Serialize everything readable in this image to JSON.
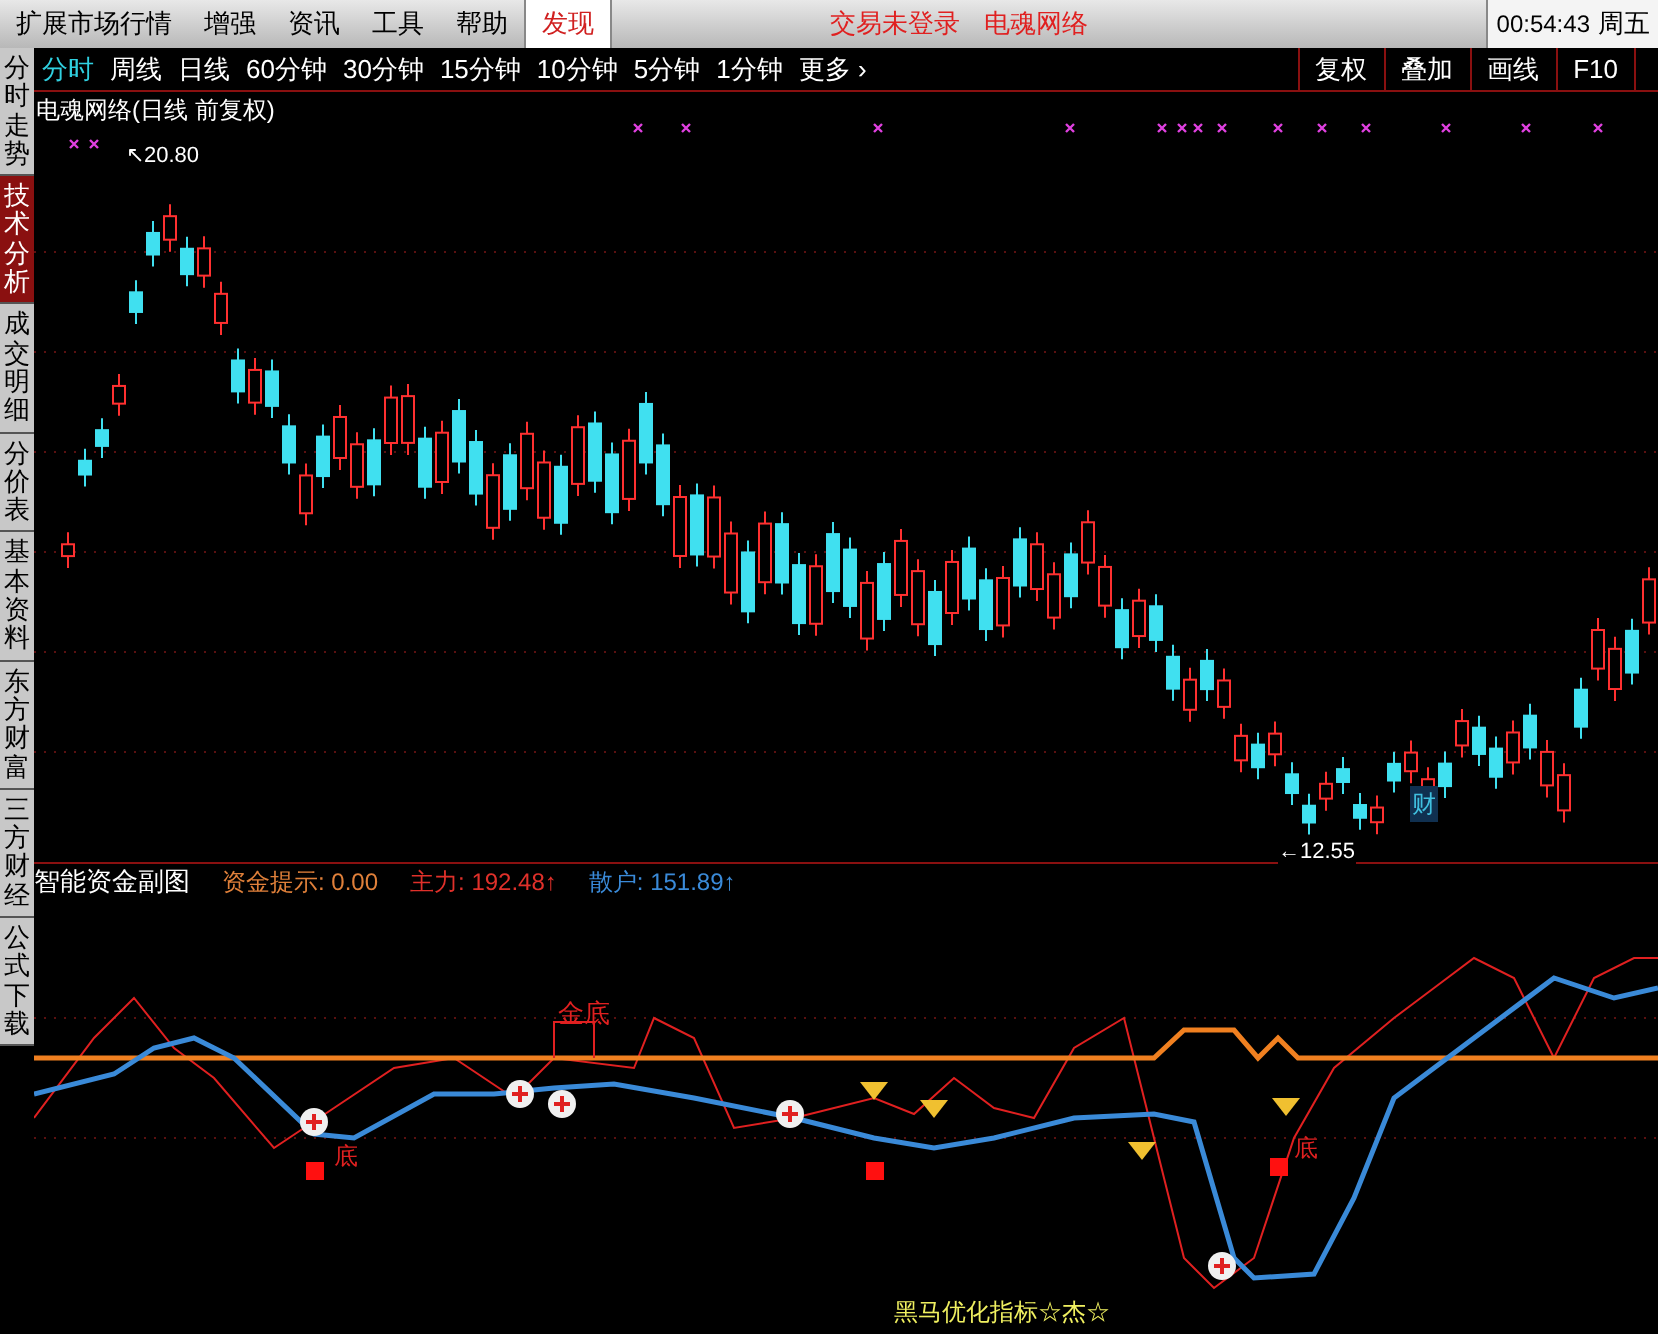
{
  "menu_bar": {
    "items": [
      {
        "label": "扩展市场行情",
        "selected": false
      },
      {
        "label": "增强",
        "selected": false
      },
      {
        "label": "资讯",
        "selected": false
      },
      {
        "label": "工具",
        "selected": false
      },
      {
        "label": "帮助",
        "selected": false
      },
      {
        "label": "发现",
        "selected": true
      }
    ],
    "status": [
      "交易未登录",
      "电魂网络"
    ],
    "clock": "00:54:43",
    "weekday": "周五"
  },
  "side_tabs": [
    {
      "label": "分时走势",
      "selected": false
    },
    {
      "label": "技术分析",
      "selected": true
    },
    {
      "label": "成交明细",
      "selected": false
    },
    {
      "label": "分价表",
      "selected": false
    },
    {
      "label": "基本资料",
      "selected": false
    },
    {
      "label": "东方财富",
      "selected": false
    },
    {
      "label": "三方财经",
      "selected": false
    },
    {
      "label": "公式下载",
      "selected": false
    }
  ],
  "period_bar": {
    "periods": [
      {
        "label": "分时",
        "selected": true
      },
      {
        "label": "周线",
        "selected": false
      },
      {
        "label": "日线",
        "selected": false
      },
      {
        "label": "60分钟",
        "selected": false
      },
      {
        "label": "30分钟",
        "selected": false
      },
      {
        "label": "15分钟",
        "selected": false
      },
      {
        "label": "10分钟",
        "selected": false
      },
      {
        "label": "5分钟",
        "selected": false
      },
      {
        "label": "1分钟",
        "selected": false
      },
      {
        "label": "更多 ›",
        "selected": false
      }
    ],
    "tools": [
      "复权",
      "叠加",
      "画线",
      "F10"
    ]
  },
  "main_chart": {
    "title": "电魂网络(日线 前复权)",
    "high_label": "↖20.80",
    "low_label": "←12.55",
    "marker": "财"
  },
  "sub_chart": {
    "title": "智能资金副图",
    "readings": [
      {
        "label": "资金提示: 0.00",
        "color": "#e0803a"
      },
      {
        "label": "主力: 192.48↑",
        "color": "#e0302a"
      },
      {
        "label": "散户: 151.89↑",
        "color": "#3a8ad8"
      }
    ],
    "signal_label": "金底",
    "bottom_labels": [
      "底",
      "底"
    ],
    "footer": "黑马优化指标☆杰☆"
  }
}
